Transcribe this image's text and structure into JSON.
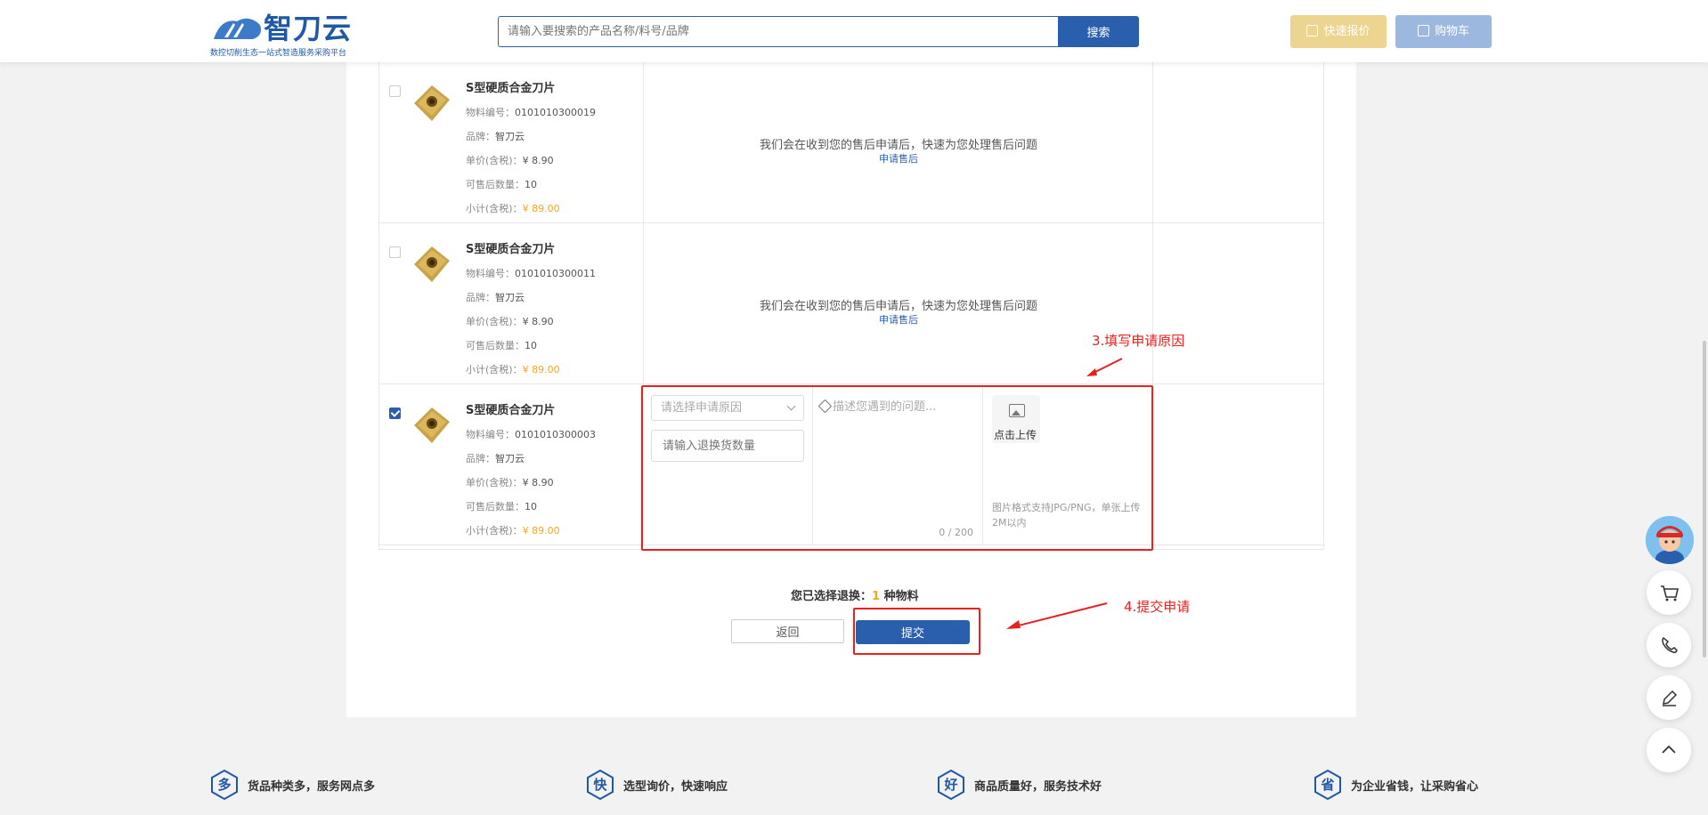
{
  "header": {
    "logo_text": "智刀云",
    "logo_sub": "数控切削生态一站式智造服务采购平台",
    "search_placeholder": "请输入要搜索的产品名称/料号/品牌",
    "search_button": "搜索",
    "quote_button": "快速报价",
    "cart_button": "购物车"
  },
  "items": [
    {
      "name": "S型硬质合金刀片",
      "code_label": "物料编号：",
      "code": "0101010300019",
      "brand_label": "品牌：",
      "brand": "智刀云",
      "price_label": "单价(含税)：",
      "price": "¥ 8.90",
      "qty_label": "可售后数量：",
      "qty": "10",
      "subtotal_label": "小计(含税)：",
      "subtotal": "¥ 89.00",
      "checked": false,
      "message": "我们会在收到您的售后申请后，快速为您处理售后问题",
      "link": "申请售后"
    },
    {
      "name": "S型硬质合金刀片",
      "code_label": "物料编号：",
      "code": "0101010300011",
      "brand_label": "品牌：",
      "brand": "智刀云",
      "price_label": "单价(含税)：",
      "price": "¥ 8.90",
      "qty_label": "可售后数量：",
      "qty": "10",
      "subtotal_label": "小计(含税)：",
      "subtotal": "¥ 89.00",
      "checked": false,
      "message": "我们会在收到您的售后申请后，快速为您处理售后问题",
      "link": "申请售后"
    },
    {
      "name": "S型硬质合金刀片",
      "code_label": "物料编号：",
      "code": "0101010300003",
      "brand_label": "品牌：",
      "brand": "智刀云",
      "price_label": "单价(含税)：",
      "price": "¥ 8.90",
      "qty_label": "可售后数量：",
      "qty": "10",
      "subtotal_label": "小计(含税)：",
      "subtotal": "¥ 89.00",
      "checked": true
    }
  ],
  "form": {
    "reason_placeholder": "请选择申请原因",
    "qty_placeholder": "请输入退换货数量",
    "desc_placeholder": "描述您遇到的问题...",
    "counter": "0 / 200",
    "upload_label": "点击上传",
    "upload_hint": "图片格式支持JPG/PNG，单张上传2M以内"
  },
  "annotations": {
    "step3": "3.填写申请原因",
    "step4": "4.提交申请"
  },
  "summary": {
    "prefix": "您已选择退换：",
    "count": "1",
    "suffix": " 种物料"
  },
  "actions": {
    "back": "返回",
    "submit": "提交"
  },
  "features": [
    {
      "icon": "多",
      "text": "货品种类多，服务网点多"
    },
    {
      "icon": "快",
      "text": "选型询价，快速响应"
    },
    {
      "icon": "好",
      "text": "商品质量好，服务技术好"
    },
    {
      "icon": "省",
      "text": "为企业省钱，让采购省心"
    }
  ],
  "colors": {
    "primary": "#2a5fae",
    "accent_orange": "#f5a623",
    "annotation_red": "#e8201e"
  }
}
